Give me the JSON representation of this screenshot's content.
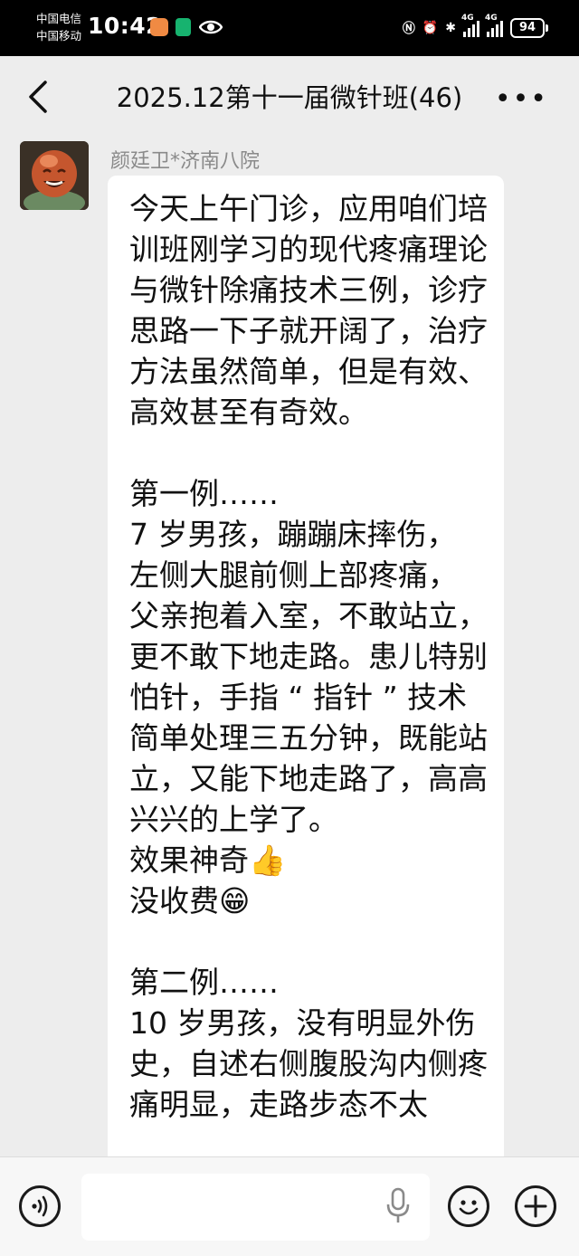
{
  "status_bar": {
    "carrier_1": "中国电信",
    "carrier_2": "中国移动",
    "time": "10:42",
    "network_1": "4G",
    "network_2": "4G",
    "battery": "94"
  },
  "header": {
    "title": "2025.12第十一届微针班(46)"
  },
  "chat": {
    "sender_name": "颜廷卫*济南八院",
    "message": "今天上午门诊，应用咱们培训班刚学习的现代疼痛理论与微针除痛技术三例，诊疗思路一下子就开阔了，治疗方法虽然简单，但是有效、高效甚至有奇效。\n\n第一例……\n7 岁男孩，蹦蹦床摔伤，\n左侧大腿前侧上部疼痛，\n父亲抱着入室，不敢站立，更不敢下地走路。患儿特别怕针，手指 “ 指针 ” 技术简单处理三五分钟，既能站立，又能下地走路了，高高兴兴的上学了。\n效果神奇👍\n没收费😁\n\n第二例……\n10 岁男孩，没有明显外伤史，自述右侧腹股沟内侧疼痛明显，走路步态不太"
  },
  "input_bar": {
    "placeholder": ""
  }
}
